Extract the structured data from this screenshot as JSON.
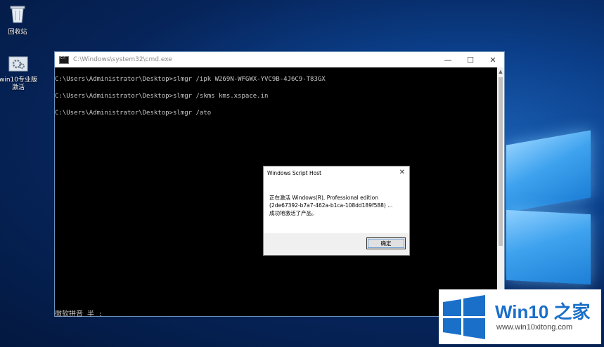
{
  "desktop": {
    "icons": [
      {
        "label": "回收站",
        "icon": "recycle-bin-icon"
      },
      {
        "label": "win10专业版\n激活",
        "icon": "activation-tool-icon"
      }
    ]
  },
  "cmd_window": {
    "title": "C:\\Windows\\system32\\cmd.exe",
    "controls": {
      "minimize": "—",
      "maximize": "☐",
      "close": "✕"
    },
    "lines": [
      "C:\\Users\\Administrator\\Desktop>slmgr /ipk W269N-WFGWX-YVC9B-4J6C9-T83GX",
      "C:\\Users\\Administrator\\Desktop>slmgr /skms kms.xspace.in",
      "C:\\Users\\Administrator\\Desktop>slmgr /ato"
    ],
    "ime_status": "微软拼音 半 :"
  },
  "dialog": {
    "title": "Windows Script Host",
    "close": "✕",
    "message": [
      "正在激活 Windows(R), Professional edition",
      "(2de67392-b7a7-462a-b1ca-108dd189f588) ...",
      "成功地激活了产品。"
    ],
    "ok_button": "确定"
  },
  "watermark": {
    "title": "Win10 之家",
    "url": "www.win10xitong.com",
    "colors": {
      "blue": "#1a6fc9"
    }
  }
}
